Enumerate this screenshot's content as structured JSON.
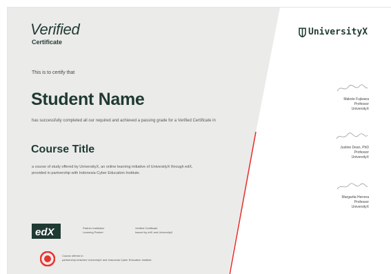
{
  "certificate": {
    "heading": "Verified",
    "subheading": "Certificate",
    "certify_text": "This is to certify that",
    "student_name": "Student Name",
    "completion_text": "has successfully completed all our required and achieved a passing grade for a Verified Certificate in",
    "course_title": "Course Title",
    "course_description": "a course of study offered by UniversityX, an online learning initiative of UniversityX through edX, provided in partnership with Indonesia Cyber Education Institute."
  },
  "footer": {
    "edx_logo": "edX",
    "sig1_name": "Partner Institution",
    "sig1_role": "Learning Partner",
    "sig2_name": "Verified Certificate",
    "sig2_role": "Issued by edX and UniversityX",
    "partner_label": "Course offered in",
    "partner_text": "partnership between UniversityX and Indonesia Cyber Education Institute"
  },
  "brand": {
    "logo_text": "UniversityX",
    "accent": "#e8332f",
    "dark_green": "#1f3a32",
    "panel_gray": "#ebebe9"
  },
  "signatories": [
    {
      "name": "Makoto Fujiwara",
      "title": "Professor",
      "org": "UniversityX"
    },
    {
      "name": "Justine Dean, PhD",
      "title": "Professor",
      "org": "UniversityX"
    },
    {
      "name": "Margarita Herrera",
      "title": "Professor",
      "org": "UniversityX"
    }
  ]
}
